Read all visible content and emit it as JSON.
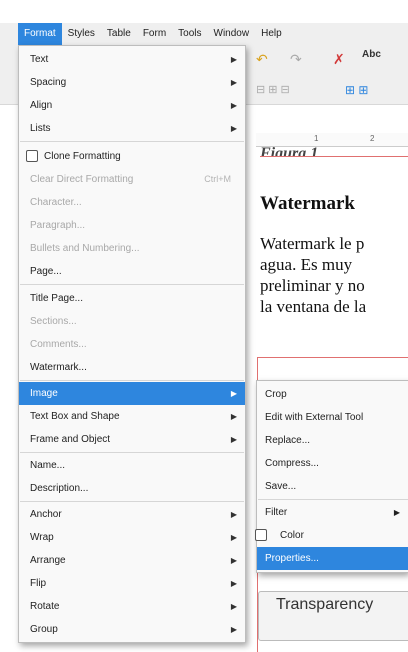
{
  "menubar": {
    "items": [
      "Format",
      "Styles",
      "Table",
      "Form",
      "Tools",
      "Window",
      "Help"
    ],
    "active_index": 0
  },
  "toolbar": {
    "icons": [
      "undo-icon",
      "redo-icon",
      "clear-formatting-icon",
      "spellcheck-icon",
      "align-icons",
      "table-icons"
    ]
  },
  "ruler": {
    "ticks": [
      "1",
      "2"
    ]
  },
  "document": {
    "figure_caption": "Figura 1",
    "heading": "Watermark",
    "paragraph_lines": [
      "Watermark le p",
      "agua. Es muy",
      "preliminar y no",
      "la ventana de la"
    ],
    "transparency_label": "Transparency"
  },
  "format_menu": {
    "items": [
      {
        "label": "Text",
        "submenu": true
      },
      {
        "label": "Spacing",
        "submenu": true
      },
      {
        "label": "Align",
        "submenu": true
      },
      {
        "label": "Lists",
        "submenu": true
      },
      {
        "label": "Clone Formatting",
        "checkbox": true
      },
      {
        "label": "Clear Direct Formatting",
        "disabled": true,
        "shortcut": "Ctrl+M"
      },
      {
        "label": "Character...",
        "disabled": true
      },
      {
        "label": "Paragraph...",
        "disabled": true
      },
      {
        "label": "Bullets and Numbering...",
        "disabled": true
      },
      {
        "label": "Page..."
      },
      {
        "label": "Title Page..."
      },
      {
        "label": "Sections...",
        "disabled": true
      },
      {
        "label": "Comments...",
        "disabled": true
      },
      {
        "label": "Watermark..."
      },
      {
        "label": "Image",
        "submenu": true,
        "active": true
      },
      {
        "label": "Text Box and Shape",
        "submenu": true
      },
      {
        "label": "Frame and Object",
        "submenu": true
      },
      {
        "label": "Name..."
      },
      {
        "label": "Description..."
      },
      {
        "label": "Anchor",
        "submenu": true
      },
      {
        "label": "Wrap",
        "submenu": true
      },
      {
        "label": "Arrange",
        "submenu": true
      },
      {
        "label": "Flip",
        "submenu": true
      },
      {
        "label": "Rotate",
        "submenu": true
      },
      {
        "label": "Group",
        "submenu": true
      }
    ]
  },
  "image_submenu": {
    "items": [
      {
        "label": "Crop"
      },
      {
        "label": "Edit with External Tool"
      },
      {
        "label": "Replace..."
      },
      {
        "label": "Compress..."
      },
      {
        "label": "Save..."
      },
      {
        "label": "Filter",
        "submenu": true
      },
      {
        "label": "Color",
        "checkbox": true
      },
      {
        "label": "Properties...",
        "active": true
      }
    ]
  },
  "colors": {
    "accent": "#2e86de",
    "disabled_text": "#a8a8a8",
    "menu_bg": "#f9f9f9"
  }
}
